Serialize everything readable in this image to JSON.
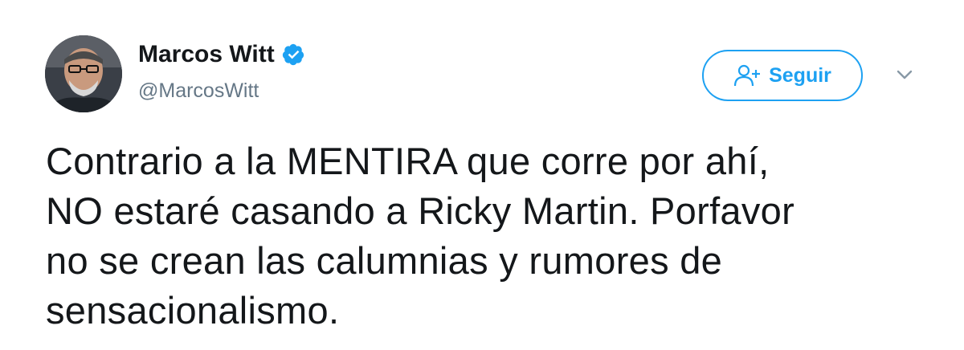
{
  "author": {
    "name": "Marcos Witt",
    "handle": "@MarcosWitt",
    "verified": true
  },
  "actions": {
    "follow_label": "Seguir"
  },
  "tweet": {
    "text": "Contrario a la MENTIRA que corre por ahí,\nNO estaré casando a Ricky Martin. Porfavor\nno se crean las calumnias y rumores de\nsensacionalismo."
  },
  "colors": {
    "accent": "#1da1f2",
    "text_primary": "#14171a",
    "text_secondary": "#657786"
  },
  "icons": {
    "verified": "verified-badge-icon",
    "follow": "add-user-icon",
    "more": "chevron-down-icon"
  }
}
